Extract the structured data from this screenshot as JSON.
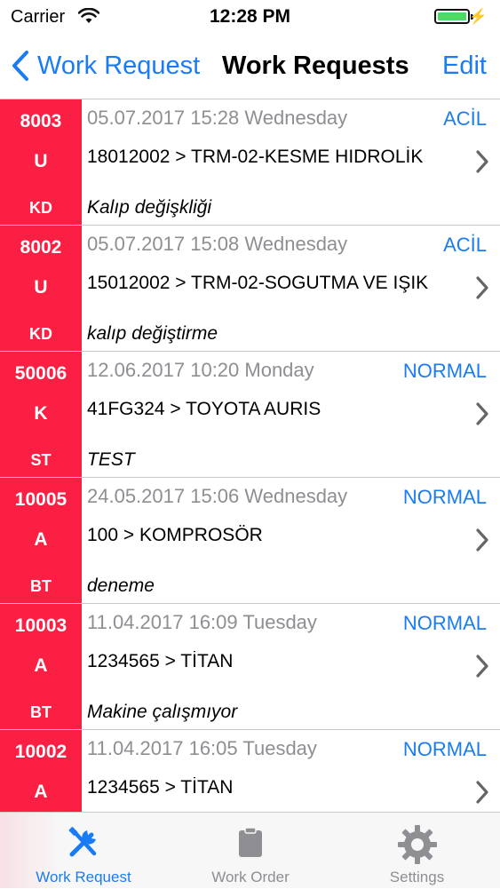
{
  "status_bar": {
    "carrier": "Carrier",
    "time": "12:28 PM",
    "battery_color": "#4cd964"
  },
  "nav": {
    "back_label": "Work Request",
    "title": "Work Requests",
    "edit_label": "Edit",
    "accent": "#1a7cf5"
  },
  "rows": [
    {
      "id": "8003",
      "code": "U",
      "dept": "KD",
      "date": "05.07.2017 15:28 Wednesday",
      "priority": "ACİL",
      "target": "18012002 > TRM-02-KESME HIDROLİK",
      "description": "Kalıp değişkliği"
    },
    {
      "id": "8002",
      "code": "U",
      "dept": "KD",
      "date": "05.07.2017 15:08 Wednesday",
      "priority": "ACİL",
      "target": "15012002 > TRM-02-SOGUTMA VE IŞIK",
      "description": "kalıp değiştirme"
    },
    {
      "id": "50006",
      "code": "K",
      "dept": "ST",
      "date": "12.06.2017 10:20 Monday",
      "priority": "NORMAL",
      "target": "41FG324 > TOYOTA AURIS",
      "description": "TEST"
    },
    {
      "id": "10005",
      "code": "A",
      "dept": "BT",
      "date": "24.05.2017 15:06 Wednesday",
      "priority": "NORMAL",
      "target": "100  > KOMPROSÖR",
      "description": "deneme"
    },
    {
      "id": "10003",
      "code": "A",
      "dept": "BT",
      "date": "11.04.2017 16:09 Tuesday",
      "priority": "NORMAL",
      "target": "1234565 > TİTAN",
      "description": "Makine çalışmıyor"
    },
    {
      "id": "10002",
      "code": "A",
      "dept": "",
      "date": "11.04.2017 16:05 Tuesday",
      "priority": "NORMAL",
      "target": "1234565 > TİTAN",
      "description": ""
    }
  ],
  "row_side_color": "#fb2043",
  "tabs": [
    {
      "label": "Work Request",
      "icon": "wrench-screwdriver-icon",
      "active": true
    },
    {
      "label": "Work Order",
      "icon": "clipboard-icon",
      "active": false
    },
    {
      "label": "Settings",
      "icon": "gear-icon",
      "active": false
    }
  ]
}
